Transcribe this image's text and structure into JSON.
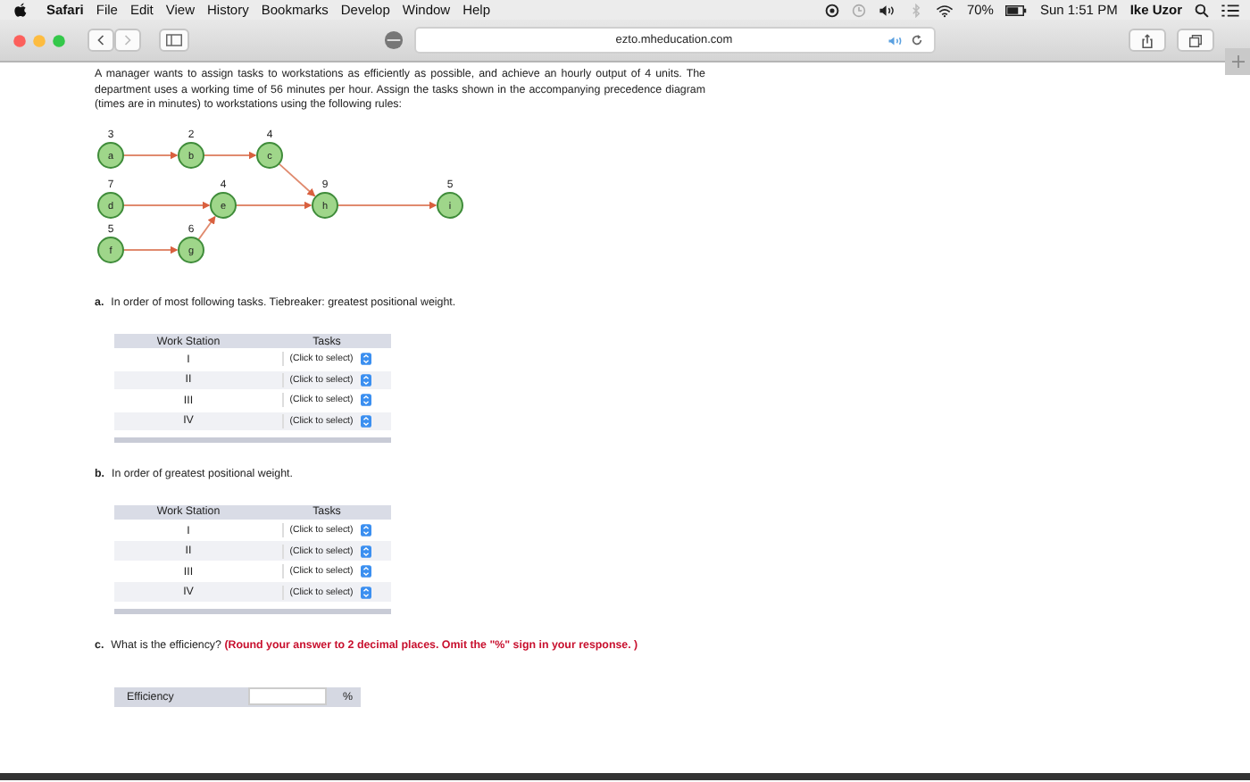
{
  "menu_bar": {
    "app": "Safari",
    "items": [
      "File",
      "Edit",
      "View",
      "History",
      "Bookmarks",
      "Develop",
      "Window",
      "Help"
    ],
    "battery": "70%",
    "clock": "Sun 1:51 PM",
    "user": "Ike Uzor"
  },
  "toolbar": {
    "address": "ezto.mheducation.com"
  },
  "question": {
    "intro": "A manager wants to assign tasks to workstations as efficiently as possible, and achieve an hourly output of 4 units. The department uses a working time of 56 minutes per hour. Assign the tasks shown in the accompanying precedence diagram (times are in minutes) to workstations using the following rules:",
    "diagram": {
      "nodes": [
        {
          "label": "a",
          "time": "3"
        },
        {
          "label": "b",
          "time": "2"
        },
        {
          "label": "c",
          "time": "4"
        },
        {
          "label": "d",
          "time": "7"
        },
        {
          "label": "e",
          "time": "4"
        },
        {
          "label": "h",
          "time": "9"
        },
        {
          "label": "i",
          "time": "5"
        },
        {
          "label": "f",
          "time": "5"
        },
        {
          "label": "g",
          "time": "6"
        }
      ]
    },
    "parts": [
      {
        "kind": "table",
        "letter": "a.",
        "prompt": "In order of most following tasks. Tiebreaker: greatest positional weight.",
        "columns": [
          "Work Station",
          "Tasks"
        ],
        "rows": [
          {
            "station": "I",
            "select": "(Click to select)"
          },
          {
            "station": "II",
            "select": "(Click to select)"
          },
          {
            "station": "III",
            "select": "(Click to select)"
          },
          {
            "station": "IV",
            "select": "(Click to select)"
          }
        ]
      },
      {
        "kind": "table",
        "letter": "b.",
        "prompt": "In order of greatest positional weight.",
        "columns": [
          "Work Station",
          "Tasks"
        ],
        "rows": [
          {
            "station": "I",
            "select": "(Click to select)"
          },
          {
            "station": "II",
            "select": "(Click to select)"
          },
          {
            "station": "III",
            "select": "(Click to select)"
          },
          {
            "station": "IV",
            "select": "(Click to select)"
          }
        ]
      },
      {
        "kind": "input",
        "letter": "c.",
        "prompt": "What is the efficiency?",
        "note": "(Round your answer to 2 decimal places. Omit the \"%\" sign in your response. )",
        "label": "Efficiency",
        "unit": "%"
      }
    ]
  }
}
